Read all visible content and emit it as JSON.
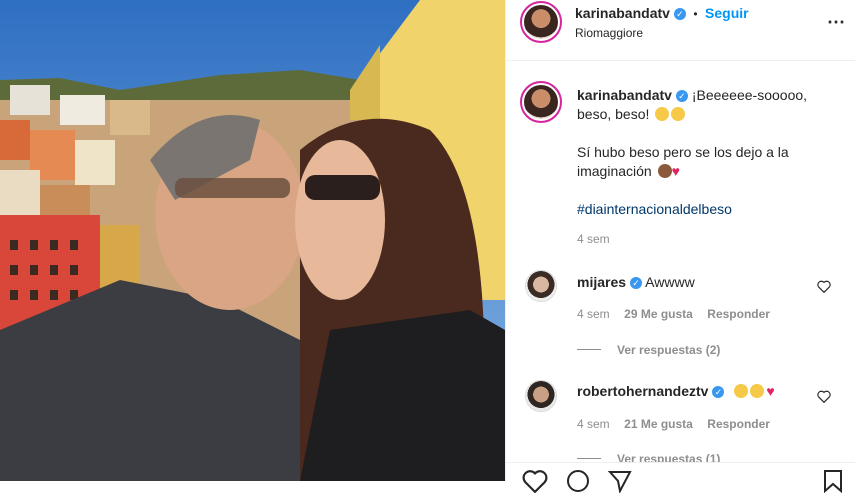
{
  "post": {
    "author": "karinabandatv",
    "follow_label": "Seguir",
    "separator": "•",
    "location": "Riomaggiore"
  },
  "caption": {
    "author": "karinabandatv",
    "text_line1": "¡Beeeeee-sooooo,",
    "text_line2": "beso, beso!",
    "text_line3": "Sí hubo beso pero se los dejo a la",
    "text_line4": "imaginación",
    "hashtag": "#diainternacionaldelbeso",
    "time": "4 sem"
  },
  "comments": [
    {
      "user": "mijares",
      "text": "Awwww",
      "time": "4 sem",
      "likes": "29 Me gusta",
      "reply_label": "Responder",
      "view_replies": "Ver respuestas (2)"
    },
    {
      "user": "robertohernandeztv",
      "text": "",
      "time": "4 sem",
      "likes": "21 Me gusta",
      "reply_label": "Responder",
      "view_replies": "Ver respuestas (1)"
    }
  ],
  "icons": [
    "more-options-icon",
    "verified-icon",
    "heart-icon",
    "comment-icon",
    "share-icon",
    "save-icon"
  ],
  "colors": {
    "accent": "#0095f6",
    "verified": "#3897f0",
    "heart_emoji": "#e0245e"
  }
}
